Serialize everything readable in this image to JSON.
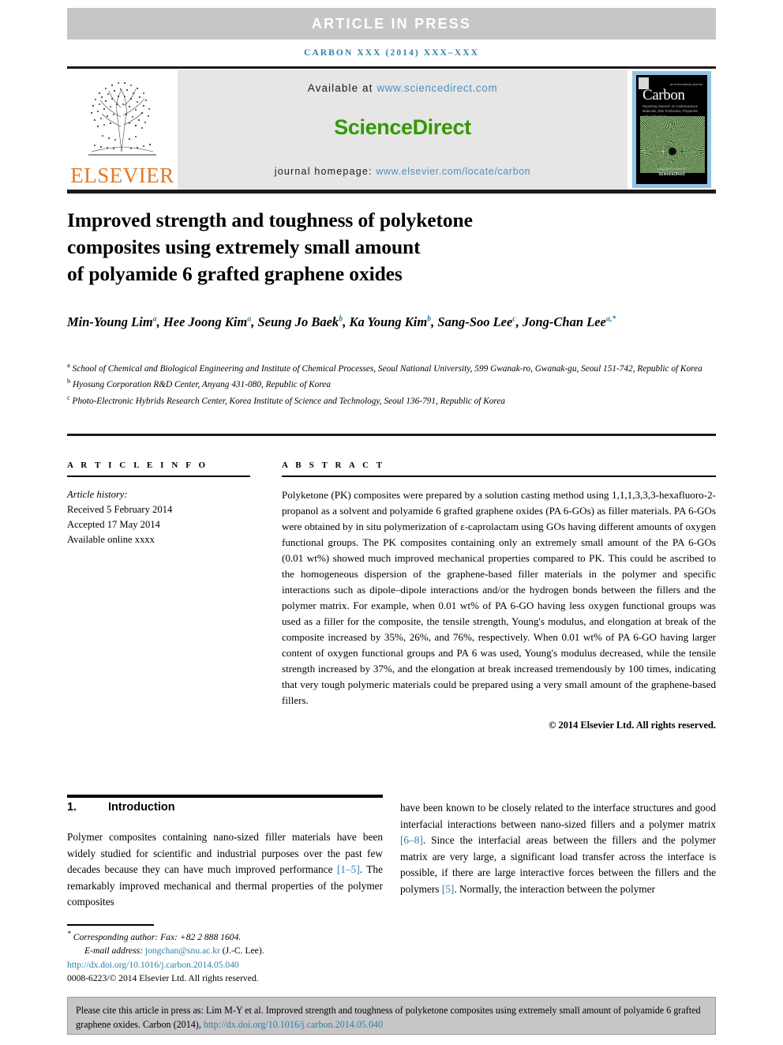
{
  "header": {
    "article_in_press": "ARTICLE IN PRESS",
    "journal_ref": "CARBON XXX (2014) XXX–XXX"
  },
  "banner": {
    "publisher": "ELSEVIER",
    "available_prefix": "Available at ",
    "available_url": "www.sciencedirect.com",
    "sciencedirect_logo": "ScienceDirect",
    "homepage_prefix": "journal homepage: ",
    "homepage_url": "www.elsevier.com/locate/carbon",
    "cover": {
      "supertitle": "an international journal",
      "title": "Carbon",
      "tagline": "Reporting research on Carbonaceous Materials, their Production, Properties and Applications",
      "footer_line1": "AVAILABLE ONLINE AT",
      "footer_line2": "ScienceDirect"
    }
  },
  "article": {
    "title_line1": "Improved strength and toughness of polyketone",
    "title_line2": "composites using extremely small amount",
    "title_line3": "of polyamide 6 grafted graphene oxides",
    "authors": [
      {
        "name": "Min-Young Lim",
        "sup": "a"
      },
      {
        "name": "Hee Joong Kim",
        "sup": "a"
      },
      {
        "name": "Seung Jo Baek",
        "sup": "b"
      },
      {
        "name": "Ka Young Kim",
        "sup": "b"
      },
      {
        "name": "Sang-Soo Lee",
        "sup": "c"
      },
      {
        "name": "Jong-Chan Lee",
        "sup": "a,*"
      }
    ],
    "affiliations": [
      {
        "marker": "a",
        "text": "School of Chemical and Biological Engineering and Institute of Chemical Processes, Seoul National University, 599 Gwanak-ro, Gwanak-gu, Seoul 151-742, Republic of Korea"
      },
      {
        "marker": "b",
        "text": "Hyosung Corporation R&D Center, Anyang 431-080, Republic of Korea"
      },
      {
        "marker": "c",
        "text": "Photo-Electronic Hybrids Research Center, Korea Institute of Science and Technology, Seoul 136-791, Republic of Korea"
      }
    ]
  },
  "article_info": {
    "heading": "A R T I C L E   I N F O",
    "history_label": "Article history:",
    "received": "Received 5 February 2014",
    "accepted": "Accepted 17 May 2014",
    "available_online": "Available online xxxx"
  },
  "abstract": {
    "heading": "A B S T R A C T",
    "body": "Polyketone (PK) composites were prepared by a solution casting method using 1,1,1,3,3,3-hexafluoro-2-propanol as a solvent and polyamide 6 grafted graphene oxides (PA 6-GOs) as filler materials. PA 6-GOs were obtained by in situ polymerization of ε-caprolactam using GOs having different amounts of oxygen functional groups. The PK composites containing only an extremely small amount of the PA 6-GOs (0.01 wt%) showed much improved mechanical properties compared to PK. This could be ascribed to the homogeneous dispersion of the graphene-based filler materials in the polymer and specific interactions such as dipole–dipole interactions and/or the hydrogen bonds between the fillers and the polymer matrix. For example, when 0.01 wt% of PA 6-GO having less oxygen functional groups was used as a filler for the composite, the tensile strength, Young's modulus, and elongation at break of the composite increased by 35%, 26%, and 76%, respectively. When 0.01 wt% of PA 6-GO having larger content of oxygen functional groups and PA 6 was used, Young's modulus decreased, while the tensile strength increased by 37%, and the elongation at break increased tremendously by 100 times, indicating that very tough polymeric materials could be prepared using a very small amount of the graphene-based fillers.",
    "copyright": "© 2014 Elsevier Ltd. All rights reserved."
  },
  "introduction": {
    "number": "1.",
    "heading": "Introduction",
    "left_part1": "Polymer composites containing nano-sized filler materials have been widely studied for scientific and industrial purposes over the past few decades because they can have much improved performance ",
    "left_cite1": "[1–5]",
    "left_part2": ". The remarkably improved mechanical and thermal properties of the polymer composites",
    "right_part1": "have been known to be closely related to the interface structures and good interfacial interactions between nano-sized fillers and a polymer matrix ",
    "right_cite1": "[6–8]",
    "right_part2": ". Since the interfacial areas between the fillers and the polymer matrix are very large, a significant load transfer across the interface is possible, if there are large interactive forces between the fillers and the polymers ",
    "right_cite2": "[5]",
    "right_part3": ". Normally, the interaction between the polymer"
  },
  "footnote": {
    "corresponding": "Corresponding author: Fax: +82 2 888 1604.",
    "email_label": "E-mail address: ",
    "email": "jongchan@snu.ac.kr",
    "email_suffix": " (J.-C. Lee).",
    "doi": "http://dx.doi.org/10.1016/j.carbon.2014.05.040",
    "issn": "0008-6223/© 2014 Elsevier Ltd. All rights reserved."
  },
  "cite_box": {
    "text_before": "Please cite this article in press as: Lim M-Y et al. Improved strength and toughness of polyketone composites using extremely small amount of polyamide 6 grafted graphene oxides. Carbon (2014), ",
    "doi": "http://dx.doi.org/10.1016/j.carbon.2014.05.040"
  },
  "colors": {
    "link": "#2e7fa8",
    "sciencedirect_green": "#339900",
    "elsevier_orange": "#e87722",
    "band_gray": "#c6c6c8"
  }
}
